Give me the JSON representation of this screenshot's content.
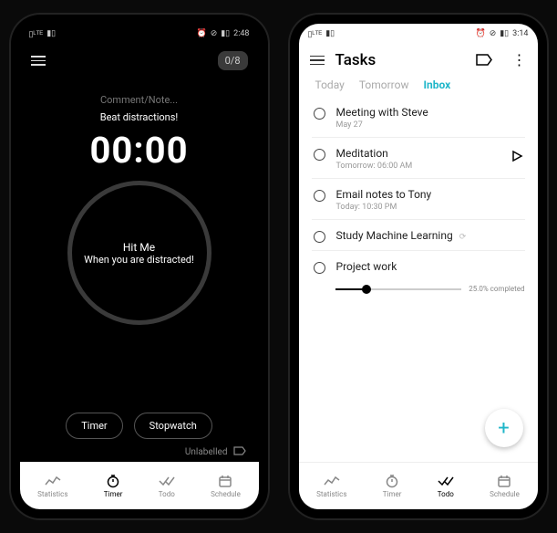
{
  "left": {
    "status": {
      "time": "2:48"
    },
    "counter": "0/8",
    "comment_placeholder": "Comment/Note...",
    "subtitle": "Beat distractions!",
    "time": "00:00",
    "ring_line1": "Hit Me",
    "ring_line2": "When you are distracted!",
    "modes": {
      "timer": "Timer",
      "stopwatch": "Stopwatch"
    },
    "label": "Unlabelled"
  },
  "right": {
    "status": {
      "time": "3:14"
    },
    "title": "Tasks",
    "tabs": {
      "today": "Today",
      "tomorrow": "Tomorrow",
      "inbox": "Inbox"
    },
    "tasks": [
      {
        "title": "Meeting with Steve",
        "sub": "May 27"
      },
      {
        "title": "Meditation",
        "sub": "Tomorrow: 06:00 AM",
        "play": true
      },
      {
        "title": "Email notes to Tony",
        "sub": "Today: 10:30 PM"
      },
      {
        "title": "Study Machine Learning",
        "repeat": true
      },
      {
        "title": "Project work"
      }
    ],
    "progress_label": "25.0% completed"
  },
  "nav": {
    "statistics": "Statistics",
    "timer": "Timer",
    "todo": "Todo",
    "schedule": "Schedule"
  }
}
